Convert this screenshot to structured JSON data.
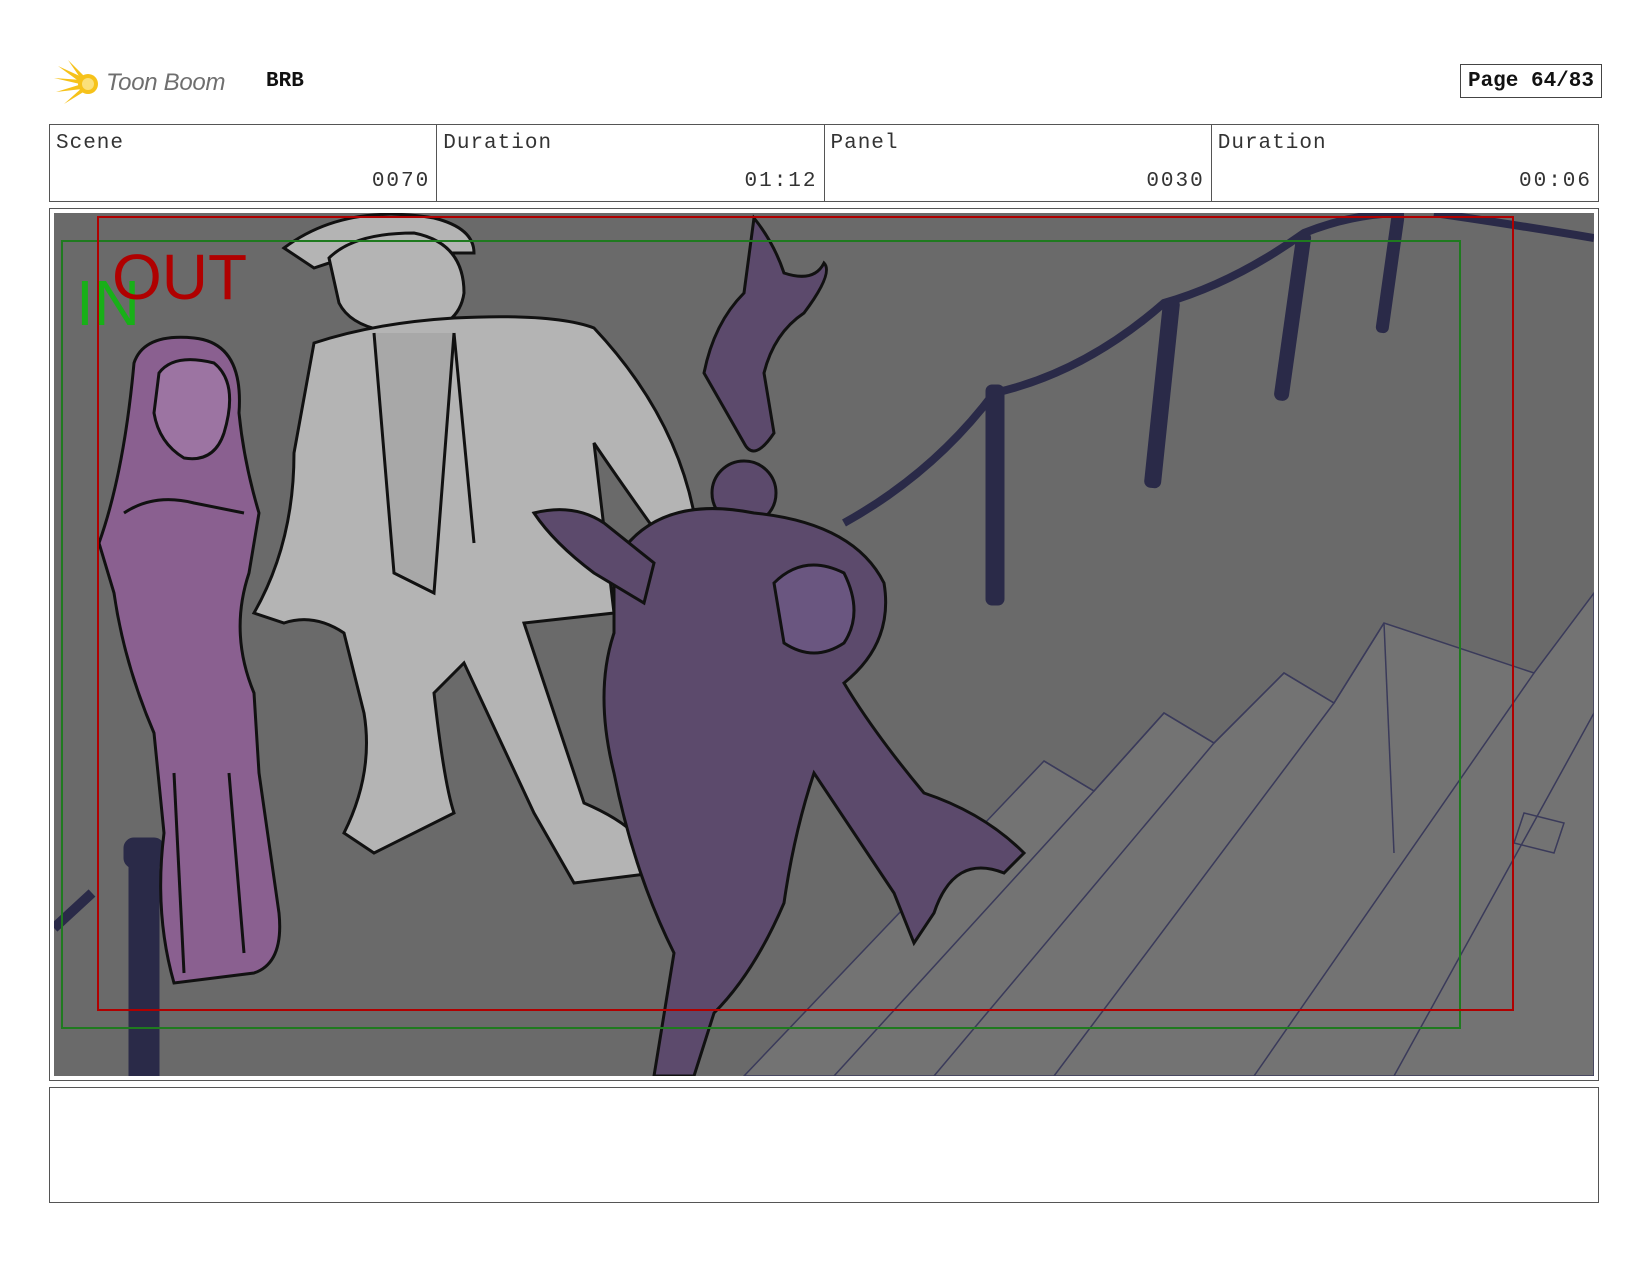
{
  "header": {
    "logo_text": "Toon Boom",
    "project": "BRB",
    "page": "Page 64/83"
  },
  "info": [
    {
      "label": "Scene",
      "value": "0070"
    },
    {
      "label": "Duration",
      "value": "01:12"
    },
    {
      "label": "Panel",
      "value": "0030"
    },
    {
      "label": "Duration",
      "value": "00:06"
    }
  ],
  "panel": {
    "in_marker": "IN",
    "out_marker": "OUT"
  },
  "caption": "",
  "colors": {
    "background_gray": "#6a6a6a",
    "character_purple": "#8a6090",
    "character_dark_purple": "#5c4a6c",
    "character_gray": "#b4b4b4",
    "railing_navy": "#2a2a48",
    "in_frame_green": "#1f7a1f",
    "out_frame_red": "#b00000"
  }
}
